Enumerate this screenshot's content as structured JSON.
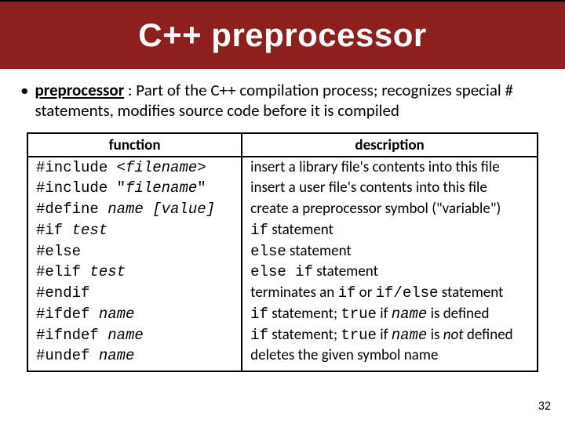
{
  "title": "C++ preprocessor",
  "bullet": {
    "term": "preprocessor",
    "rest": " : Part of the C++ compilation process; recognizes special # statements, modifies source code before it is compiled"
  },
  "table": {
    "headers": {
      "fn": "function",
      "ds": "description"
    },
    "rows": [
      {
        "fn": [
          {
            "t": "#include <",
            "c": "mono"
          },
          {
            "t": "filename",
            "c": "mono ital"
          },
          {
            "t": ">",
            "c": "mono"
          }
        ],
        "ds": [
          {
            "t": "insert a library file's contents into this file",
            "c": ""
          }
        ]
      },
      {
        "fn": [
          {
            "t": "#include \"",
            "c": "mono"
          },
          {
            "t": "filename",
            "c": "mono ital"
          },
          {
            "t": "\"",
            "c": "mono"
          }
        ],
        "ds": [
          {
            "t": "insert a user file's contents into this file",
            "c": ""
          }
        ]
      },
      {
        "fn": [
          {
            "t": "#define ",
            "c": "mono"
          },
          {
            "t": "name [value]",
            "c": "mono ital"
          }
        ],
        "ds": [
          {
            "t": "create a preprocessor symbol (\"variable\")",
            "c": ""
          }
        ]
      },
      {
        "fn": [
          {
            "t": "#if ",
            "c": "mono"
          },
          {
            "t": "test",
            "c": "mono ital"
          }
        ],
        "ds": [
          {
            "t": "if",
            "c": "mono"
          },
          {
            "t": " statement",
            "c": ""
          }
        ]
      },
      {
        "fn": [
          {
            "t": "#else",
            "c": "mono"
          }
        ],
        "ds": [
          {
            "t": "else",
            "c": "mono"
          },
          {
            "t": " statement",
            "c": ""
          }
        ]
      },
      {
        "fn": [
          {
            "t": "#elif ",
            "c": "mono"
          },
          {
            "t": "test",
            "c": "mono ital"
          }
        ],
        "ds": [
          {
            "t": "else if",
            "c": "mono"
          },
          {
            "t": " statement",
            "c": ""
          }
        ]
      },
      {
        "fn": [
          {
            "t": "#endif",
            "c": "mono"
          }
        ],
        "ds": [
          {
            "t": "terminates an ",
            "c": ""
          },
          {
            "t": "if",
            "c": "mono"
          },
          {
            "t": " or ",
            "c": ""
          },
          {
            "t": "if/else",
            "c": "mono"
          },
          {
            "t": " statement",
            "c": ""
          }
        ]
      },
      {
        "fn": [
          {
            "t": "#ifdef ",
            "c": "mono"
          },
          {
            "t": "name",
            "c": "mono ital"
          }
        ],
        "ds": [
          {
            "t": "if",
            "c": "mono"
          },
          {
            "t": " statement; ",
            "c": ""
          },
          {
            "t": "true",
            "c": "mono"
          },
          {
            "t": " if ",
            "c": ""
          },
          {
            "t": "name",
            "c": "mono ital"
          },
          {
            "t": " is defined",
            "c": ""
          }
        ]
      },
      {
        "fn": [
          {
            "t": "#ifndef ",
            "c": "mono"
          },
          {
            "t": "name",
            "c": "mono ital"
          }
        ],
        "ds": [
          {
            "t": "if",
            "c": "mono"
          },
          {
            "t": " statement; ",
            "c": ""
          },
          {
            "t": "true",
            "c": "mono"
          },
          {
            "t": " if ",
            "c": ""
          },
          {
            "t": "name",
            "c": "mono ital"
          },
          {
            "t": " is ",
            "c": ""
          },
          {
            "t": "not",
            "c": "ital"
          },
          {
            "t": " defined",
            "c": ""
          }
        ]
      },
      {
        "fn": [
          {
            "t": "#undef ",
            "c": "mono"
          },
          {
            "t": "name",
            "c": "mono ital"
          }
        ],
        "ds": [
          {
            "t": "deletes the given symbol name",
            "c": ""
          }
        ]
      }
    ]
  },
  "page_number": "32"
}
